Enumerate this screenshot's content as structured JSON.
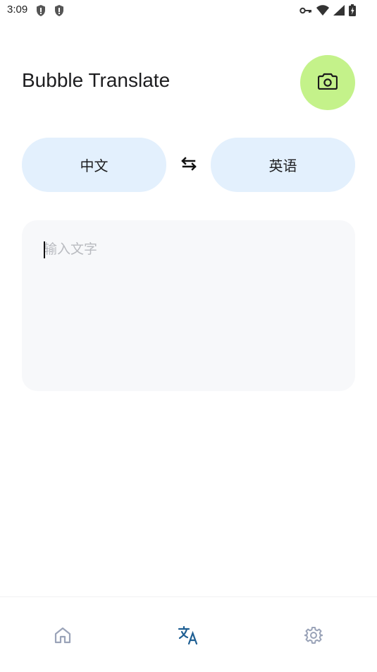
{
  "status_bar": {
    "time": "3:09",
    "icons": [
      "shield-alert-icon",
      "shield-alert-icon",
      "vpn-key-icon",
      "wifi-icon",
      "cell-signal-icon",
      "battery-charging-icon"
    ]
  },
  "header": {
    "title": "Bubble Translate",
    "camera_icon": "camera-icon",
    "fab_color": "#c4f28a"
  },
  "languages": {
    "source": "中文",
    "target": "英语",
    "swap_icon": "swap-arrows-icon",
    "pill_color": "#e3f0fd"
  },
  "input": {
    "placeholder": "输入文字",
    "value": ""
  },
  "nav": {
    "items": [
      {
        "name": "home",
        "icon": "home-icon",
        "active": false
      },
      {
        "name": "translate",
        "icon": "translate-icon",
        "active": true
      },
      {
        "name": "settings",
        "icon": "gear-icon",
        "active": false
      }
    ],
    "active_color": "#1f5f93",
    "inactive_color": "#9aa3b8"
  }
}
